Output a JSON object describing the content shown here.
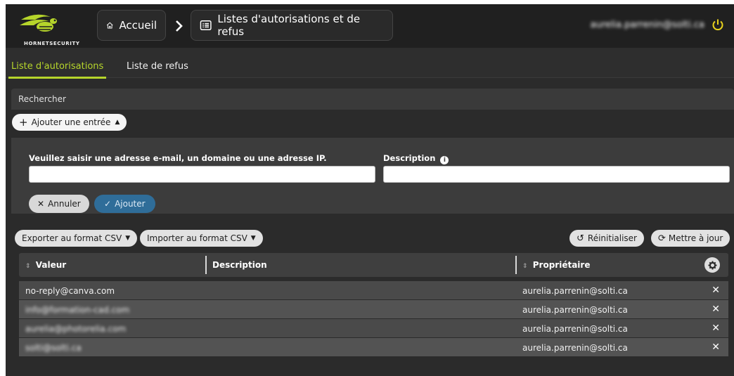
{
  "brand": {
    "name": "HORNETSECURITY",
    "accent": "#b6d52b"
  },
  "breadcrumb": {
    "home_label": "Accueil",
    "current_label": "Listes d'autorisations et de refus"
  },
  "user": {
    "email": "aurelia.parrenin@solti.ca"
  },
  "tabs": [
    {
      "label": "Liste d'autorisations",
      "active": true
    },
    {
      "label": "Liste de refus",
      "active": false
    }
  ],
  "search": {
    "label": "Rechercher"
  },
  "add_toggle": {
    "label": "Ajouter une entrée"
  },
  "form": {
    "address_label": "Veuillez saisir une adresse e-mail, un domaine ou une adresse IP.",
    "address_value": "",
    "description_label": "Description",
    "description_value": "",
    "cancel_label": "Annuler",
    "add_label": "Ajouter"
  },
  "toolbar": {
    "export_label": "Exporter au format CSV",
    "import_label": "Importer au format CSV",
    "reset_label": "Réinitialiser",
    "refresh_label": "Mettre à jour"
  },
  "table": {
    "columns": [
      "Valeur",
      "Description",
      "Propriétaire"
    ],
    "rows": [
      {
        "value": "no-reply@canva.com",
        "description": "",
        "owner": "aurelia.parrenin@solti.ca"
      },
      {
        "value": "info@formation-cad.com",
        "description": "",
        "owner": "aurelia.parrenin@solti.ca"
      },
      {
        "value": "aurelia@photorelia.com",
        "description": "",
        "owner": "aurelia.parrenin@solti.ca"
      },
      {
        "value": "solti@solti.ca",
        "description": "",
        "owner": "aurelia.parrenin@solti.ca"
      }
    ]
  }
}
